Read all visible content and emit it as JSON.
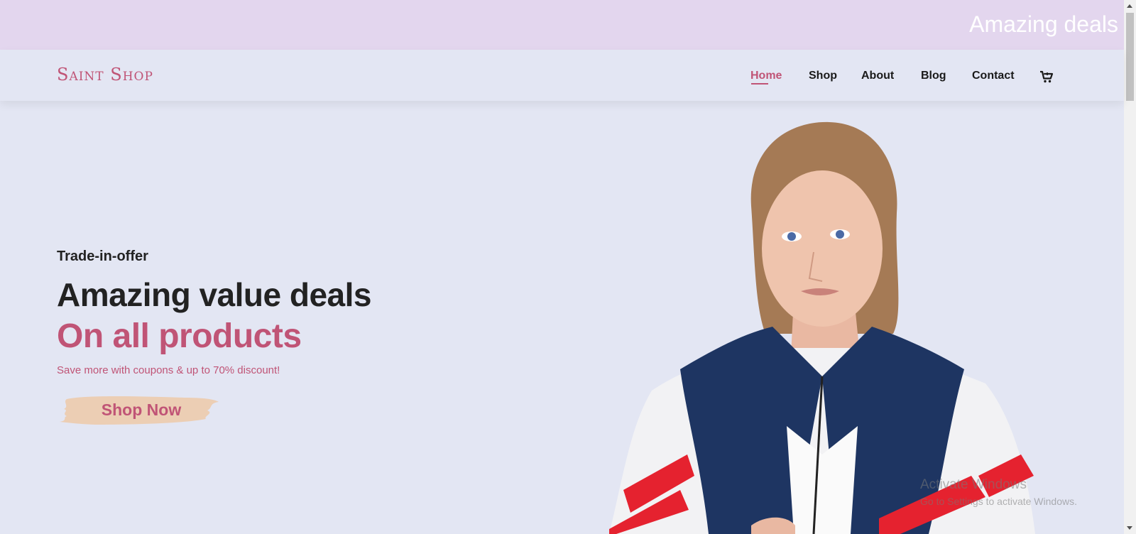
{
  "promo": {
    "text": "Amazing deals"
  },
  "header": {
    "logo": "Saint Shop",
    "nav": [
      {
        "label": "Home",
        "active": true
      },
      {
        "label": "Shop"
      },
      {
        "label": "About"
      },
      {
        "label": "Blog"
      },
      {
        "label": "Contact"
      }
    ],
    "cart_icon": "shopping-cart-icon"
  },
  "hero": {
    "eyebrow": "Trade-in-offer",
    "title": "Amazing value deals",
    "title_accent": "On all products",
    "description": "Save more with coupons & up to 70% discount!",
    "cta_label": "Shop Now"
  },
  "os_watermark": {
    "line1": "Activate Windows",
    "line2": "Go to Settings to activate Windows."
  },
  "colors": {
    "accent": "#c05476",
    "background": "#e3e6f3",
    "promo_bg": "#e3d6ee",
    "button_brush": "#ecceb4"
  }
}
